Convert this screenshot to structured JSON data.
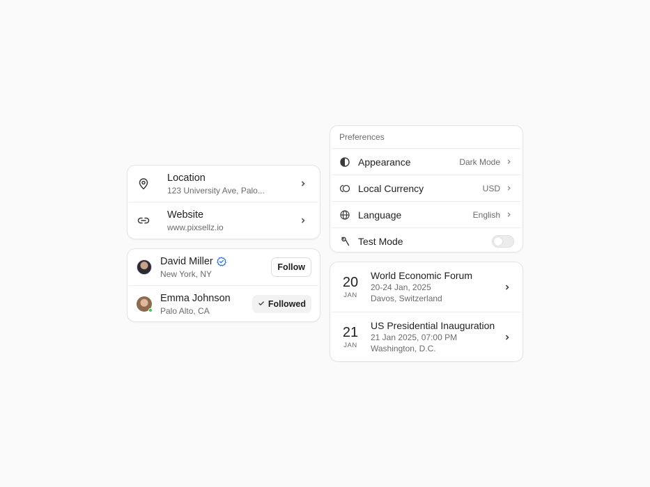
{
  "contact": {
    "items": [
      {
        "icon": "map-pin-icon",
        "title": "Location",
        "subtitle": "123 University Ave, Palo..."
      },
      {
        "icon": "link-icon",
        "title": "Website",
        "subtitle": "www.pixsellz.io"
      }
    ]
  },
  "people": {
    "items": [
      {
        "name": "David Miller",
        "location": "New York, NY",
        "verified": true,
        "action": "Follow"
      },
      {
        "name": "Emma Johnson",
        "location": "Palo Alto, CA",
        "online": true,
        "action": "Followed"
      }
    ]
  },
  "preferences": {
    "header": "Preferences",
    "items": [
      {
        "icon": "contrast-icon",
        "label": "Appearance",
        "value": "Dark Mode"
      },
      {
        "icon": "currency-icon",
        "label": "Local Currency",
        "value": "USD"
      },
      {
        "icon": "globe-icon",
        "label": "Language",
        "value": "English"
      },
      {
        "icon": "wrench-icon",
        "label": "Test Mode",
        "toggle": false
      }
    ]
  },
  "events": {
    "items": [
      {
        "day": "20",
        "month": "JAN",
        "title": "World Economic Forum",
        "date": "20-24 Jan, 2025",
        "place": "Davos, Switzerland"
      },
      {
        "day": "21",
        "month": "JAN",
        "title": "US Presidential Inauguration",
        "date": "21 Jan 2025, 07:00 PM",
        "place": "Washington, D.C."
      }
    ]
  },
  "colors": {
    "background": "#fafafa",
    "card": "#ffffff",
    "border": "#e4e4e4",
    "verified": "#2f6fde",
    "online": "#34c759"
  }
}
